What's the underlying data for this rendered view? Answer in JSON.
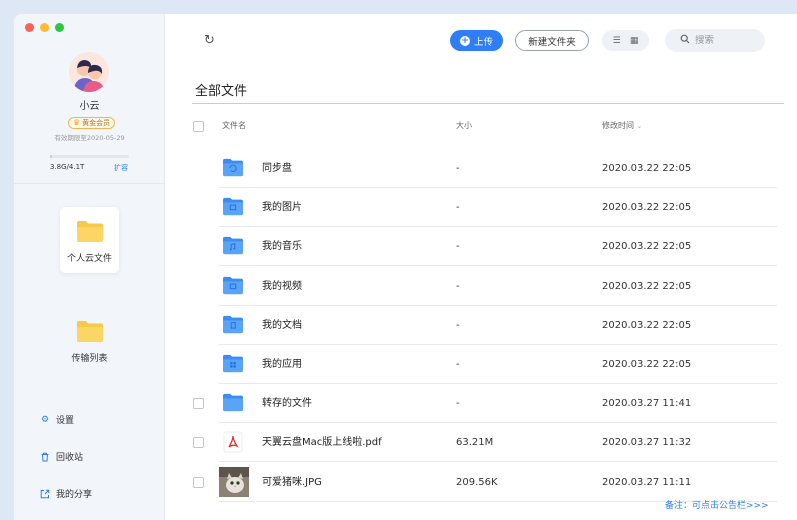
{
  "sidebar": {
    "username": "小云",
    "vip_badge": "黄金会员",
    "expire": "有效期限至2020-05-29",
    "quota_text": "3.8G/4.1T",
    "quota_fraction": 0.001,
    "expand": "扩容",
    "cards": [
      {
        "label": "个人云文件",
        "active": true
      },
      {
        "label": "传输列表",
        "active": false
      }
    ],
    "links": [
      {
        "label": "设置",
        "icon": "gear-icon"
      },
      {
        "label": "回收站",
        "icon": "trash-icon"
      },
      {
        "label": "我的分享",
        "icon": "share-icon"
      }
    ]
  },
  "toolbar": {
    "upload": "上传",
    "new_folder": "新建文件夹",
    "search_placeholder": "搜索"
  },
  "main": {
    "title": "全部文件",
    "columns": {
      "name": "文件名",
      "size": "大小",
      "date": "修改时间"
    },
    "rows": [
      {
        "name": "同步盘",
        "size": "-",
        "date": "2020.03.22 22:05",
        "icon": "folder-sync-icon",
        "checkbox": false
      },
      {
        "name": "我的图片",
        "size": "-",
        "date": "2020.03.22 22:05",
        "icon": "folder-image-icon",
        "checkbox": false
      },
      {
        "name": "我的音乐",
        "size": "-",
        "date": "2020.03.22 22:05",
        "icon": "folder-music-icon",
        "checkbox": false
      },
      {
        "name": "我的视频",
        "size": "-",
        "date": "2020.03.22 22:05",
        "icon": "folder-video-icon",
        "checkbox": false
      },
      {
        "name": "我的文档",
        "size": "-",
        "date": "2020.03.22 22:05",
        "icon": "folder-document-icon",
        "checkbox": false
      },
      {
        "name": "我的应用",
        "size": "-",
        "date": "2020.03.22 22:05",
        "icon": "folder-app-icon",
        "checkbox": false
      },
      {
        "name": "转存的文件",
        "size": "-",
        "date": "2020.03.27 11:41",
        "icon": "folder-icon",
        "checkbox": true
      },
      {
        "name": "天翼云盘Mac版上线啦.pdf",
        "size": "63.21M",
        "date": "2020.03.27 11:32",
        "icon": "pdf-icon",
        "checkbox": true
      },
      {
        "name": "可爱猪咪.JPG",
        "size": "209.56K",
        "date": "2020.03.27 11:11",
        "icon": "image-thumbnail-icon",
        "checkbox": true
      }
    ]
  },
  "notice": "备注：可点击公告栏>>>",
  "colors": {
    "accent": "#2f7ef5",
    "folder": "#4a9af5",
    "sidebar_bg": "#f2f5fa"
  }
}
